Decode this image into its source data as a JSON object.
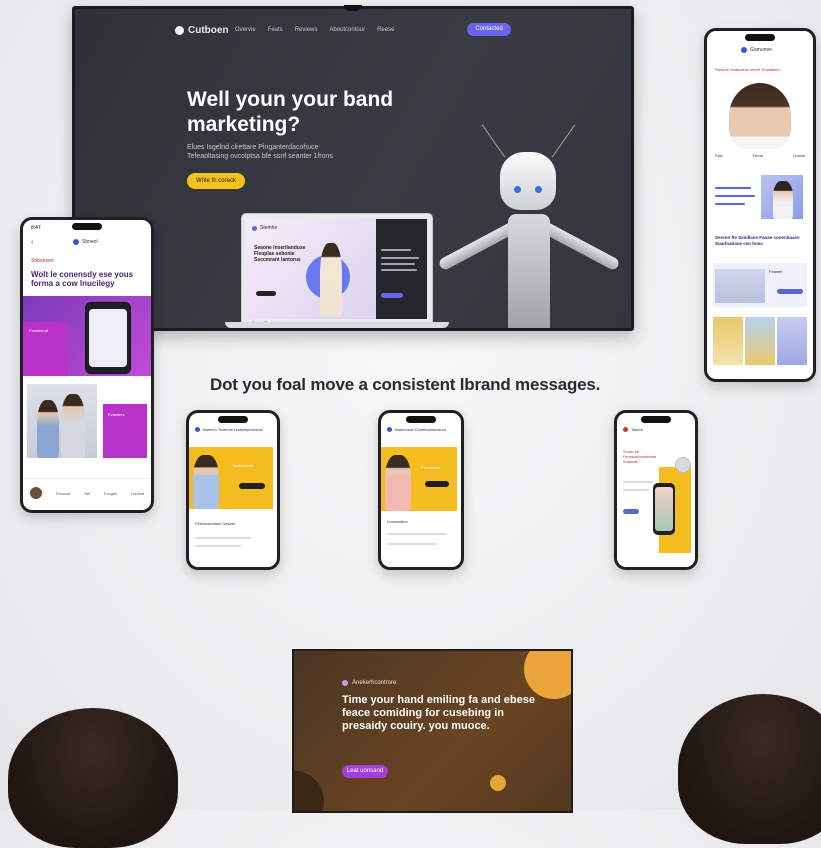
{
  "tv": {
    "brand": "Cutboen",
    "nav": [
      "Overvie",
      "Feats",
      "Reviews",
      "Aboutcontour",
      "Reese"
    ],
    "top_button": "Contacted",
    "title": "Well youn your band marketing?",
    "description": "Elues Isgelnd clrettare Pinganterdacohuce Tefeaoltasing ovcolptsa bfe ssnf seanter 1frons",
    "cta": "Write fn coreck",
    "laptop_brand": "Stemhe",
    "laptop_title": "Seaone Inserlianduse Fleuplas sebonie Ssccmrant lantorus",
    "laptop_footer": "Jeane Gaelmo"
  },
  "phone_left": {
    "time": "8:47",
    "brand": "Sbneol",
    "tag": "Shbonsen",
    "headline": "Wolt le conensdy ese yous forma a cow lnucilegy",
    "card_label": "Feastrenul",
    "card_label_2": "Evastlers",
    "nav": [
      "Faccont",
      "Tsli",
      "Fnvgitn",
      "Lonfest"
    ]
  },
  "phone_right": {
    "brand": "Gamunee",
    "tagline": "Fsleeve Zeaticohte oerelf Trealabelu",
    "stats": [
      "Fsle",
      "Ferne",
      "Lbsrlie"
    ],
    "section_title": "Serenn fte Ssedlane Fanae conentiaase Suarloatiane cen hnes",
    "card_text": "Feaneh"
  },
  "headline": "Dot you foal move a consistent lbrand messages.",
  "phone_mid1": {
    "title": "Baeeeu Tcoterne Ieseeeyenicsnel",
    "card_text": "Ilasteronee",
    "footer": "Ffrentsacnlnse Desotrt"
  },
  "phone_mid2": {
    "title": "Baeornrae Cloeehansecauul",
    "card_text": "Faentersot",
    "footer": "Loosoudine"
  },
  "phone_mid3": {
    "brand": "Tasere",
    "title": "Snner ytr Feursoclhoontarne Snauuie"
  },
  "bottom_screen": {
    "brand": "Anekerhcontrore",
    "title": "Time your hand emiling fa and ebese feace comiding for cusebing in presaidy couiry. you muoce.",
    "cta": "Leat uonsand"
  },
  "colors": {
    "accent_purple": "#6b63f0",
    "cta_yellow": "#f4c21b",
    "magenta": "#b83ad6",
    "bottom_button": "#a23fd6"
  }
}
